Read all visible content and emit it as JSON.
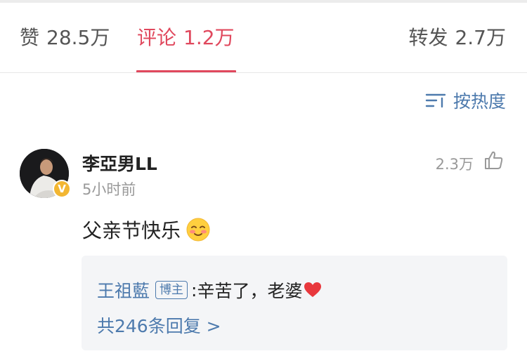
{
  "tabs": {
    "likes": {
      "label": "赞",
      "count": "28.5万"
    },
    "comments": {
      "label": "评论",
      "count": "1.2万"
    },
    "reposts": {
      "label": "转发",
      "count": "2.7万"
    },
    "active": "comments"
  },
  "sort": {
    "label": "按热度",
    "icon": "sort-icon"
  },
  "comment": {
    "username": "李亞男LL",
    "time": "5小时前",
    "like_count": "2.3万",
    "content": "父亲节快乐",
    "verified_badge": "V",
    "reply": {
      "username": "王祖藍",
      "badge": "博主",
      "separator": ":",
      "text": "辛苦了，老婆",
      "total_text": "共246条回复 >"
    }
  },
  "colors": {
    "accent": "#e0485d",
    "link": "#4d7aad",
    "verified": "#f2b632",
    "reply_bg": "#f4f5f7"
  }
}
